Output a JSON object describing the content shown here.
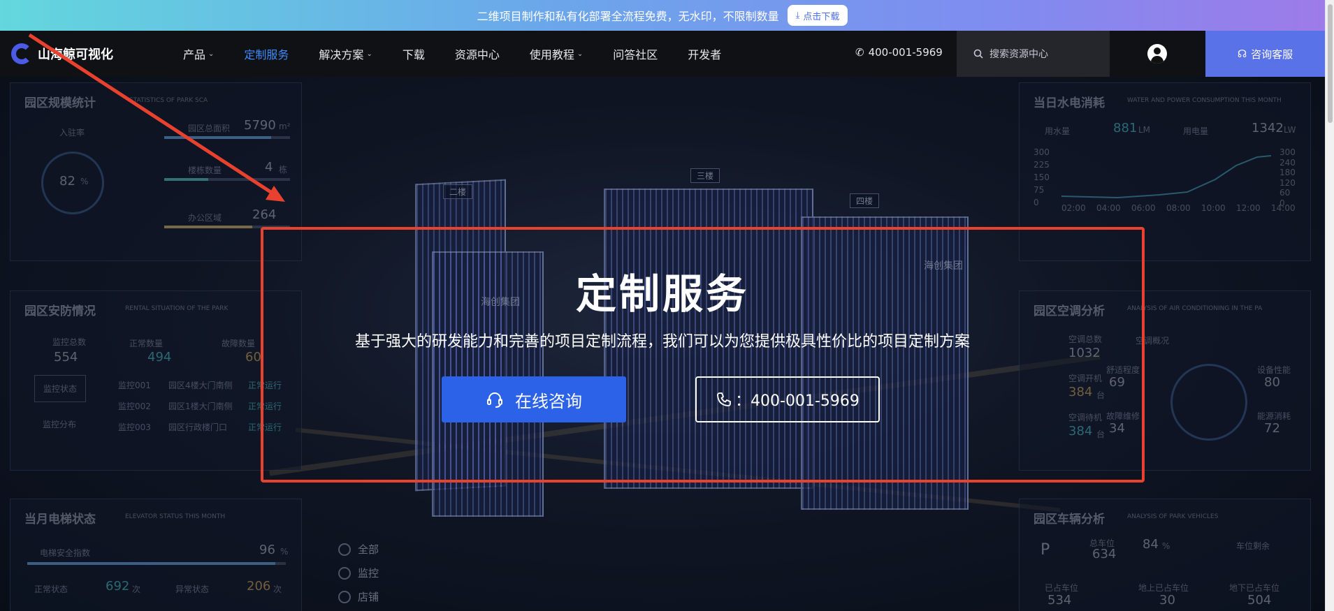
{
  "promo": {
    "text": "二维项目制作和私有化部署全流程免费，无水印，不限制数量",
    "button": "点击下载"
  },
  "nav": {
    "logo": "山海鲸可视化",
    "items": [
      {
        "label": "产品",
        "dropdown": true,
        "active": false
      },
      {
        "label": "定制服务",
        "dropdown": false,
        "active": true
      },
      {
        "label": "解决方案",
        "dropdown": true,
        "active": false
      },
      {
        "label": "下载",
        "dropdown": false,
        "active": false
      },
      {
        "label": "资源中心",
        "dropdown": false,
        "active": false
      },
      {
        "label": "使用教程",
        "dropdown": true,
        "active": false
      },
      {
        "label": "问答社区",
        "dropdown": false,
        "active": false
      },
      {
        "label": "开发者",
        "dropdown": false,
        "active": false
      }
    ],
    "phone": "400-001-5969",
    "search_placeholder": "搜索资源中心",
    "consult": "咨询客服"
  },
  "hero": {
    "title": "定制服务",
    "subtitle": "基于强大的研发能力和完善的项目定制流程，我们可以为您提供极具性价比的项目定制方案",
    "primary_button": "在线咨询",
    "phone_button": "：400-001-5969"
  },
  "background": {
    "park_scale": {
      "title": "园区规模统计",
      "subtitle": "STATISTICS OF PARK SCA",
      "select": "入驻率",
      "gauge": "82",
      "gauge_unit": "%",
      "rows": [
        {
          "label": "园区总面积",
          "value": "5790",
          "unit": "m²"
        },
        {
          "label": "楼栋数量",
          "value": "4",
          "unit": "栋"
        },
        {
          "label": "办公区域",
          "value": "264",
          "unit": ""
        }
      ]
    },
    "security": {
      "title": "园区安防情况",
      "subtitle": "RENTAL SITUATION OF THE PARK",
      "total_label": "监控总数",
      "total": "554",
      "normal_label": "正常数量",
      "normal": "494",
      "fault_label": "故障数量",
      "fault": "60",
      "tabs": [
        "监控状态",
        "监控分布"
      ],
      "rows": [
        {
          "id": "监控001",
          "loc": "园区4楼大门南侧",
          "status": "正常运行"
        },
        {
          "id": "监控002",
          "loc": "园区1楼大门南侧",
          "status": "正常运行"
        },
        {
          "id": "监控003",
          "loc": "园区行政楼门口",
          "status": "正常运行"
        }
      ]
    },
    "elevator": {
      "title": "当月电梯状态",
      "subtitle": "ELEVATOR STATUS THIS MONTH",
      "safety_label": "电梯安全指数",
      "safety": "96",
      "safety_unit": "%",
      "normal_label": "正常状态",
      "normal": "692",
      "abnormal_label": "异常状态",
      "abnormal": "206",
      "times_unit": "次"
    },
    "utility": {
      "title": "当日水电消耗",
      "subtitle": "WATER AND POWER CONSUMPTION THIS MONTH",
      "water_label": "用水量",
      "water": "881",
      "water_unit": "LM",
      "power_label": "用电量",
      "power": "1342",
      "power_unit": "LW",
      "y_left": [
        "300",
        "225",
        "150",
        "75",
        "0"
      ],
      "y_right": [
        "300",
        "240",
        "180",
        "120",
        "60",
        "0"
      ],
      "x": [
        "02:00",
        "04:00",
        "06:00",
        "08:00",
        "10:00",
        "12:00",
        "14:00"
      ]
    },
    "ac": {
      "title": "园区空调分析",
      "subtitle": "ANALYSIS OF AIR CONDITIONING IN THE PA",
      "total_label": "空调总数",
      "total": "1032",
      "on_label": "空调开机",
      "on": "384",
      "standby_label": "空调待机",
      "standby": "384",
      "unit": "台",
      "overview": "空调概况",
      "score1_label": "舒适程度",
      "score1": "69",
      "score2_label": "设备性能",
      "score2": "80",
      "score3_label": "故障维修",
      "score3": "34",
      "score4_label": "能源消耗",
      "score4": "72",
      "score_unit": "分"
    },
    "vehicles": {
      "title": "园区车辆分析",
      "subtitle": "ANALYSIS OF PARK VEHICLES",
      "p": "P",
      "total_label": "总车位",
      "total": "634",
      "pct": "84",
      "pct_unit": "%",
      "pct_label": "车位剩余",
      "occupied_label": "已占车位",
      "occupied": "534",
      "ground_label": "地上已占车位",
      "ground": "30",
      "under_label": "地下已占车位",
      "under": "504"
    },
    "legend": [
      "全部",
      "监控",
      "店铺"
    ],
    "building_labels": [
      "二楼",
      "三楼",
      "四楼"
    ],
    "building_signs": [
      "海创集团",
      "海创集团"
    ]
  }
}
